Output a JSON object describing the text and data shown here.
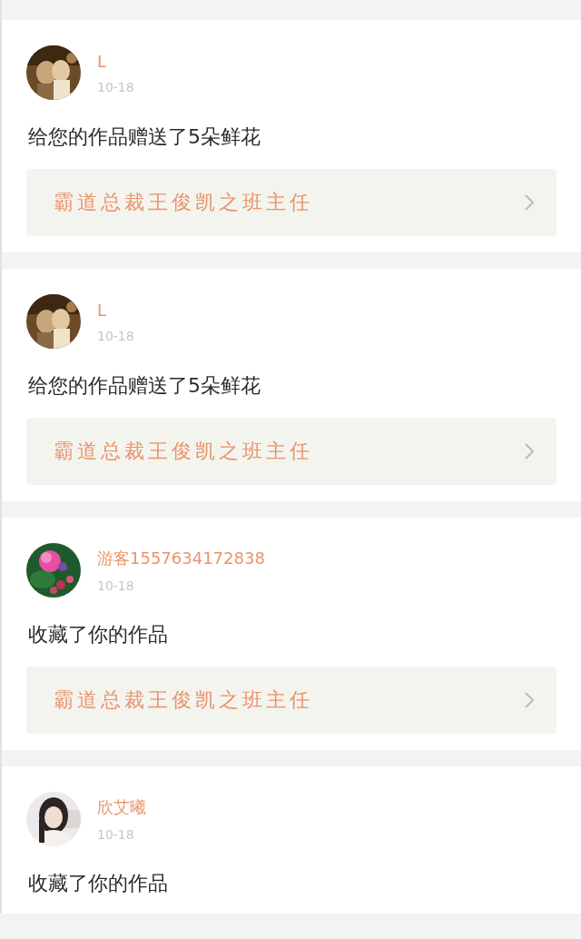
{
  "notifications": [
    {
      "user": "L",
      "date": "10-18",
      "message": "给您的作品赠送了5朵鲜花",
      "work": "霸道总裁王俊凯之班主任"
    },
    {
      "user": "L",
      "date": "10-18",
      "message": "给您的作品赠送了5朵鲜花",
      "work": "霸道总裁王俊凯之班主任"
    },
    {
      "user": "游客1557634172838",
      "date": "10-18",
      "message": "收藏了你的作品",
      "work": "霸道总裁王俊凯之班主任"
    },
    {
      "user": "欣艾曦",
      "date": "10-18",
      "message": "收藏了你的作品"
    }
  ]
}
